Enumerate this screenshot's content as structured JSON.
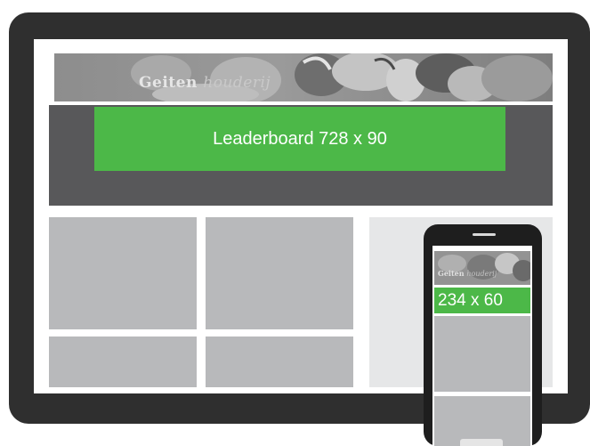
{
  "banner": {
    "logo_bold": "Geiten",
    "logo_light": "houderij"
  },
  "leaderboard": {
    "label": "Leaderboard 728 x 90"
  },
  "phone": {
    "logo_bold": "Geiten",
    "logo_light": "houderij",
    "ad_label": "234 x 60"
  },
  "colors": {
    "frame": "#2f2f2f",
    "ad_green": "#4cb848",
    "leaderboard_band": "#58585a",
    "tile_gray": "#b8b9bb",
    "sidebar_gray": "#e6e7e8"
  }
}
